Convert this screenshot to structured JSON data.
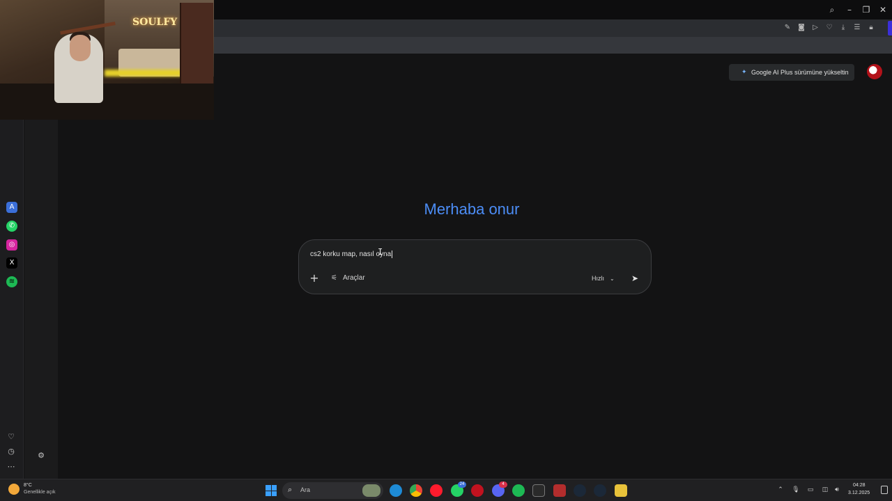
{
  "webcam": {
    "neon_sign": "SOULFY"
  },
  "window": {
    "controls": {
      "search_icon": "search-icon",
      "minimize": "–",
      "maximize": "❐",
      "close": "✕"
    }
  },
  "page": {
    "upgrade_button": "Google AI Plus sürümüne yükseltin",
    "greeting": "Merhaba onur",
    "composer": {
      "input_value": "cs2 korku map, nasıl oyna",
      "tools_label": "Araçlar",
      "mode_label": "Hızlı"
    }
  },
  "taskbar": {
    "weather_temp": "8°C",
    "weather_desc": "Genellikle açık",
    "search_placeholder": "Ara",
    "whatsapp_badge": "24",
    "discord_badge": "4",
    "time": "04:28",
    "date": "3.12.2025"
  },
  "colors": {
    "background": "#131314",
    "greeting_blue": "#4c8df6",
    "composer_bg": "#1e1f20",
    "taskbar_bg": "#202022"
  }
}
